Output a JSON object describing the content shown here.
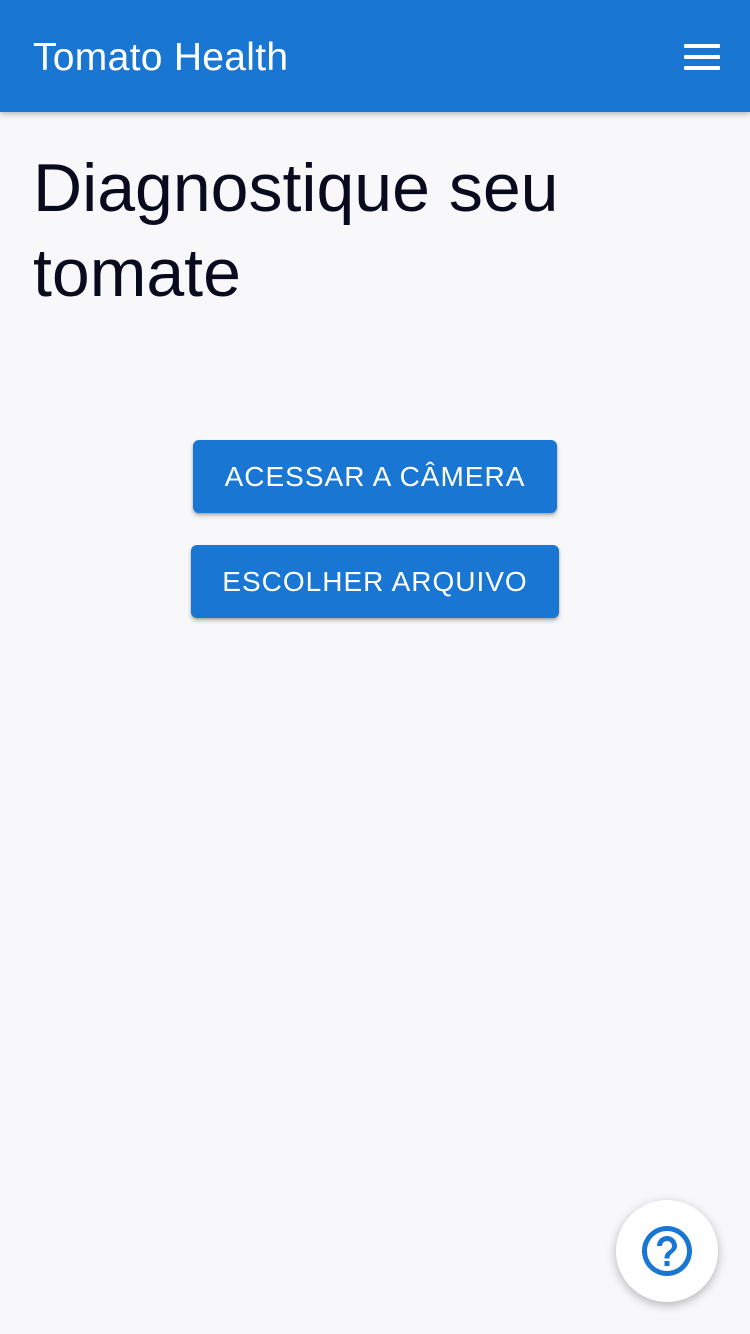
{
  "appbar": {
    "title": "Tomato Health",
    "menu_icon": "hamburger-menu-icon"
  },
  "main": {
    "heading": "Diagnostique seu tomate",
    "camera_button_label": "ACESSAR A CÂMERA",
    "file_button_label": "ESCOLHER ARQUIVO"
  },
  "help_fab": {
    "icon": "help-question-icon"
  },
  "colors": {
    "primary": "#1976d2",
    "background": "#f8f8fb",
    "text": "#0a0a1e"
  }
}
